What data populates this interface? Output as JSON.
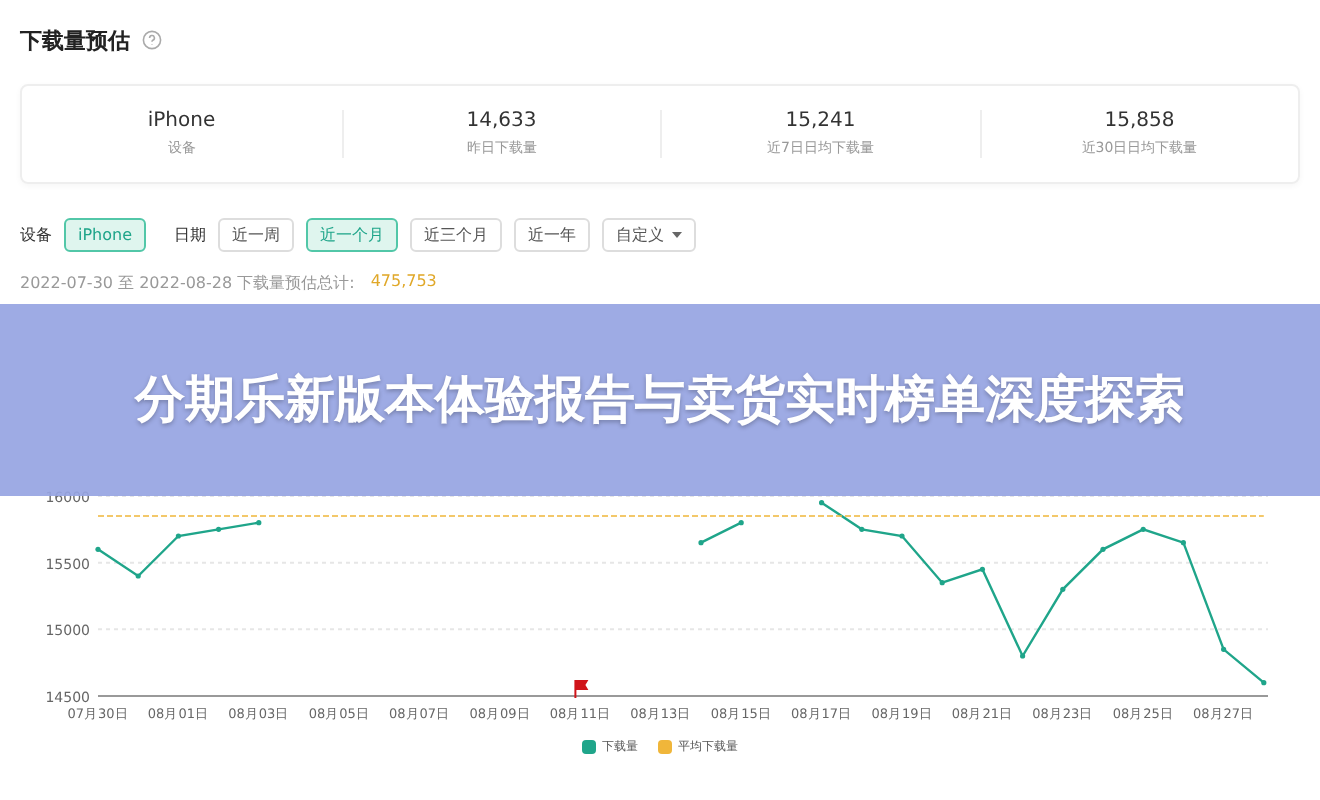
{
  "header": {
    "title": "下载量预估"
  },
  "stats": [
    {
      "value": "iPhone",
      "label": "设备"
    },
    {
      "value": "14,633",
      "label": "昨日下载量"
    },
    {
      "value": "15,241",
      "label": "近7日日均下载量"
    },
    {
      "value": "15,858",
      "label": "近30日日均下载量"
    }
  ],
  "filters": {
    "device_label": "设备",
    "devices": [
      {
        "label": "iPhone",
        "selected": true
      }
    ],
    "date_label": "日期",
    "ranges": [
      {
        "label": "近一周",
        "selected": false,
        "kind": "option"
      },
      {
        "label": "近一个月",
        "selected": true,
        "kind": "option"
      },
      {
        "label": "近三个月",
        "selected": false,
        "kind": "option"
      },
      {
        "label": "近一年",
        "selected": false,
        "kind": "option"
      },
      {
        "label": "自定义",
        "selected": false,
        "kind": "dropdown"
      }
    ]
  },
  "summary": {
    "text": "2022-07-30 至 2022-08-28 下载量预估总计:",
    "total": "475,753"
  },
  "chart_data": {
    "type": "line",
    "grid": true,
    "categories": [
      "07月30日",
      null,
      "08月01日",
      null,
      "08月03日",
      null,
      "08月05日",
      null,
      "08月07日",
      null,
      "08月09日",
      null,
      "08月11日",
      null,
      "08月13日",
      null,
      "08月15日",
      null,
      "08月17日",
      null,
      "08月19日",
      null,
      "08月21日",
      null,
      "08月23日",
      null,
      "08月25日",
      null,
      "08月27日",
      null
    ],
    "series": [
      {
        "name": "下载量",
        "color": "#1fa58a",
        "line_style": "solid",
        "values": [
          15600,
          15400,
          15700,
          15750,
          15800,
          null,
          null,
          null,
          null,
          null,
          null,
          null,
          null,
          null,
          null,
          15650,
          15800,
          null,
          15950,
          15750,
          15700,
          15350,
          15450,
          14800,
          15300,
          15600,
          15750,
          15650,
          14850,
          14600
        ]
      },
      {
        "name": "平均下载量",
        "color": "#f0b63a",
        "line_style": "dashed",
        "values": [
          15850,
          15850,
          15850,
          15850,
          15850,
          15850,
          15850,
          15850,
          15850,
          15850,
          15850,
          15850,
          15850,
          15850,
          15850,
          15850,
          15850,
          15850,
          15850,
          15850,
          15850,
          15850,
          15850,
          15850,
          15850,
          15850,
          15850,
          15850,
          15850,
          15850
        ]
      }
    ],
    "ylim": [
      14500,
      16000
    ],
    "yticks": [
      14500,
      15000,
      15500,
      16000
    ]
  },
  "banner": {
    "title": "分期乐新版本体验报告与卖货实时榜单深度探索"
  }
}
